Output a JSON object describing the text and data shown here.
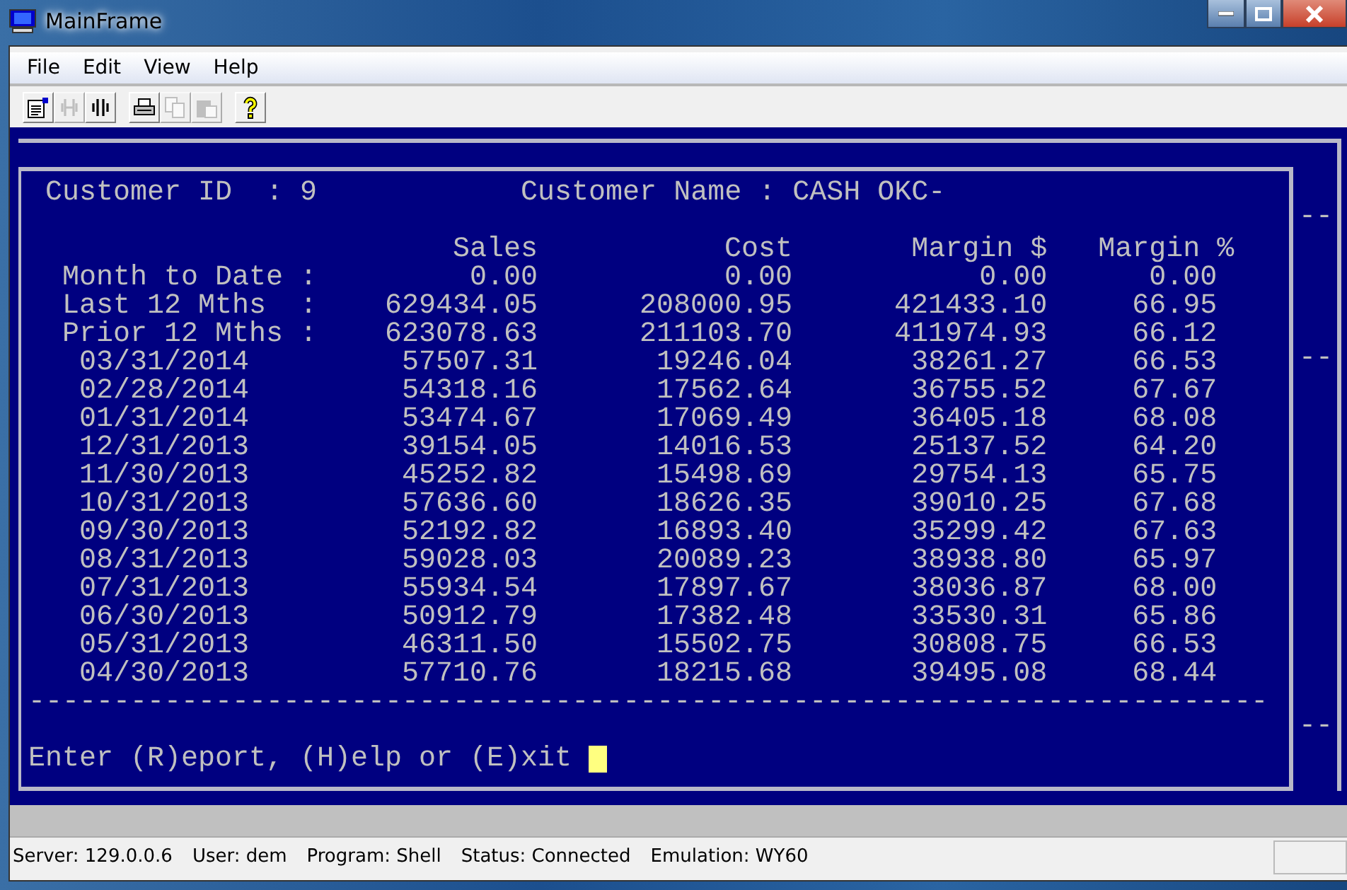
{
  "window": {
    "title": "MainFrame"
  },
  "menu": [
    "File",
    "Edit",
    "View",
    "Help"
  ],
  "toolbar": [
    {
      "kind": "properties",
      "disabled": false
    },
    {
      "kind": "connect",
      "disabled": true
    },
    {
      "kind": "disconnect",
      "disabled": false
    },
    {
      "kind": "print",
      "disabled": false
    },
    {
      "kind": "copy",
      "disabled": true
    },
    {
      "kind": "paste",
      "disabled": true
    },
    {
      "kind": "help",
      "disabled": false
    }
  ],
  "terminal": {
    "customer_id": "Customer ID  : 9",
    "customer_name": "Customer Name : CASH OKC-",
    "columns": [
      "Sales",
      "Cost",
      "Margin $",
      "Margin %"
    ],
    "rows": [
      {
        "kind": "summary",
        "label": "Month to Date :",
        "values": [
          "0.00",
          "0.00",
          "0.00",
          "0.00"
        ]
      },
      {
        "kind": "summary",
        "label": "Last 12 Mths  :",
        "values": [
          "629434.05",
          "208000.95",
          "421433.10",
          "66.95"
        ]
      },
      {
        "kind": "summary",
        "label": "Prior 12 Mths :",
        "values": [
          "623078.63",
          "211103.70",
          "411974.93",
          "66.12"
        ]
      },
      {
        "kind": "month",
        "label": "03/31/2014",
        "values": [
          "57507.31",
          "19246.04",
          "38261.27",
          "66.53"
        ]
      },
      {
        "kind": "month",
        "label": "02/28/2014",
        "values": [
          "54318.16",
          "17562.64",
          "36755.52",
          "67.67"
        ]
      },
      {
        "kind": "month",
        "label": "01/31/2014",
        "values": [
          "53474.67",
          "17069.49",
          "36405.18",
          "68.08"
        ]
      },
      {
        "kind": "month",
        "label": "12/31/2013",
        "values": [
          "39154.05",
          "14016.53",
          "25137.52",
          "64.20"
        ]
      },
      {
        "kind": "month",
        "label": "11/30/2013",
        "values": [
          "45252.82",
          "15498.69",
          "29754.13",
          "65.75"
        ]
      },
      {
        "kind": "month",
        "label": "10/31/2013",
        "values": [
          "57636.60",
          "18626.35",
          "39010.25",
          "67.68"
        ]
      },
      {
        "kind": "month",
        "label": "09/30/2013",
        "values": [
          "52192.82",
          "16893.40",
          "35299.42",
          "67.63"
        ]
      },
      {
        "kind": "month",
        "label": "08/31/2013",
        "values": [
          "59028.03",
          "20089.23",
          "38938.80",
          "65.97"
        ]
      },
      {
        "kind": "month",
        "label": "07/31/2013",
        "values": [
          "55934.54",
          "17897.67",
          "38036.87",
          "68.00"
        ]
      },
      {
        "kind": "month",
        "label": "06/30/2013",
        "values": [
          "50912.79",
          "17382.48",
          "33530.31",
          "65.86"
        ]
      },
      {
        "kind": "month",
        "label": "05/31/2013",
        "values": [
          "46311.50",
          "15502.75",
          "30808.75",
          "66.53"
        ]
      },
      {
        "kind": "month",
        "label": "04/30/2013",
        "values": [
          "57710.76",
          "18215.68",
          "39495.08",
          "68.44"
        ]
      }
    ],
    "separator": "-------------------------------------------------------------------------",
    "prompt": "Enter (R)eport, (H)elp or (E)xit",
    "side_marks": [
      "--",
      "--",
      "--"
    ]
  },
  "status_bar": [
    "Server: 129.0.0.6",
    "User: dem",
    "Program: Shell",
    "Status: Connected",
    "Emulation: WY60"
  ]
}
